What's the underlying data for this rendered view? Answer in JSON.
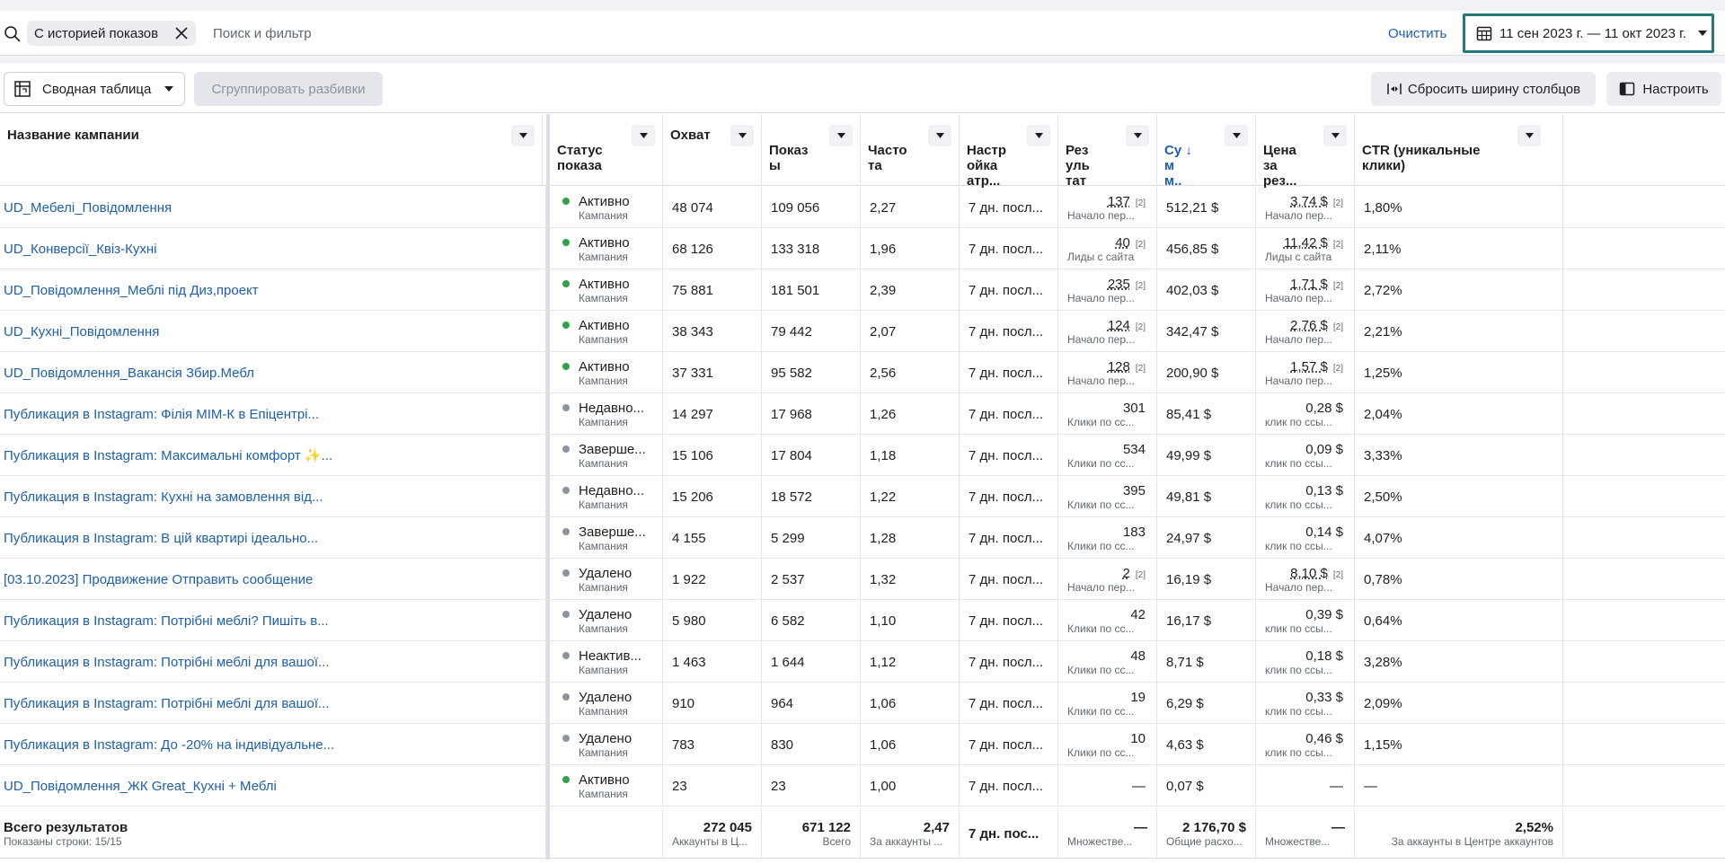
{
  "filter": {
    "chip_label": "С историей показов",
    "placeholder": "Поиск и фильтр",
    "clear_label": "Очистить",
    "date_range": "11 сен 2023 г. — 11 окт 2023 г."
  },
  "toolbar": {
    "pivot_label": "Сводная таблица",
    "group_label": "Сгруппировать разбивки",
    "reset_label": "Сбросить ширину столбцов",
    "settings_label": "Настроить"
  },
  "columns": {
    "name": "Название кампании",
    "status": "Статус\nпоказа",
    "reach": "Охват",
    "impressions": "Показ\nы",
    "frequency": "Часто\nта",
    "attribution": "Настр\nойка\nатр...",
    "results": "Рез\nуль\nтат",
    "spend": "Су ↓\nм\nм..",
    "cost": "Цена\nза\nрез...",
    "ctr": "CTR (уникальные\nклики)"
  },
  "rows": [
    {
      "name": "UD_Мебелі_Повідомлення",
      "status": "Активно",
      "status_sub": "Кампания",
      "active": true,
      "reach": "48 074",
      "impressions": "109 056",
      "frequency": "2,27",
      "attribution": "7 дн. посл...",
      "results": "137",
      "results_sup": "[2]",
      "results_label": "Начало пер...",
      "spend": "512,21 $",
      "cost": "3,74 $",
      "cost_sup": "[2]",
      "cost_label": "Начало пер...",
      "ctr": "1,80%"
    },
    {
      "name": "UD_Конверсії_Квіз-Кухні",
      "status": "Активно",
      "status_sub": "Кампания",
      "active": true,
      "reach": "68 126",
      "impressions": "133 318",
      "frequency": "1,96",
      "attribution": "7 дн. посл...",
      "results": "40",
      "results_sup": "[2]",
      "results_label": "Лиды с сайта",
      "spend": "456,85 $",
      "cost": "11,42 $",
      "cost_sup": "[2]",
      "cost_label": "Лиды с сайта",
      "ctr": "2,11%"
    },
    {
      "name": "UD_Повідомлення_Меблі під Диз,проект",
      "status": "Активно",
      "status_sub": "Кампания",
      "active": true,
      "reach": "75 881",
      "impressions": "181 501",
      "frequency": "2,39",
      "attribution": "7 дн. посл...",
      "results": "235",
      "results_sup": "[2]",
      "results_label": "Начало пер...",
      "spend": "402,03 $",
      "cost": "1,71 $",
      "cost_sup": "[2]",
      "cost_label": "Начало пер...",
      "ctr": "2,72%"
    },
    {
      "name": "UD_Кухні_Повідомлення",
      "status": "Активно",
      "status_sub": "Кампания",
      "active": true,
      "reach": "38 343",
      "impressions": "79 442",
      "frequency": "2,07",
      "attribution": "7 дн. посл...",
      "results": "124",
      "results_sup": "[2]",
      "results_label": "Начало пер...",
      "spend": "342,47 $",
      "cost": "2,76 $",
      "cost_sup": "[2]",
      "cost_label": "Начало пер...",
      "ctr": "2,21%"
    },
    {
      "name": "UD_Повідомлення_Вакансія Збир.Мебл",
      "status": "Активно",
      "status_sub": "Кампания",
      "active": true,
      "reach": "37 331",
      "impressions": "95 582",
      "frequency": "2,56",
      "attribution": "7 дн. посл...",
      "results": "128",
      "results_sup": "[2]",
      "results_label": "Начало пер...",
      "spend": "200,90 $",
      "cost": "1,57 $",
      "cost_sup": "[2]",
      "cost_label": "Начало пер...",
      "ctr": "1,25%"
    },
    {
      "name": "Публикация в Instagram: Філія МІМ-К в Епіцентрі...",
      "status": "Недавно...",
      "status_sub": "Кампания",
      "active": false,
      "reach": "14 297",
      "impressions": "17 968",
      "frequency": "1,26",
      "attribution": "7 дн. посл...",
      "results": "301",
      "results_sup": "",
      "results_label": "Клики по сс...",
      "spend": "85,41 $",
      "cost": "0,28 $",
      "cost_sup": "",
      "cost_label": "клик по ссы...",
      "ctr": "2,04%"
    },
    {
      "name": "Публикация в Instagram: Максимальні комфорт ✨...",
      "status": "Заверше...",
      "status_sub": "Кампания",
      "active": false,
      "reach": "15 106",
      "impressions": "17 804",
      "frequency": "1,18",
      "attribution": "7 дн. посл...",
      "results": "534",
      "results_sup": "",
      "results_label": "Клики по сс...",
      "spend": "49,99 $",
      "cost": "0,09 $",
      "cost_sup": "",
      "cost_label": "клик по ссы...",
      "ctr": "3,33%"
    },
    {
      "name": "Публикация в Instagram: Кухні на замовлення від...",
      "status": "Недавно...",
      "status_sub": "Кампания",
      "active": false,
      "reach": "15 206",
      "impressions": "18 572",
      "frequency": "1,22",
      "attribution": "7 дн. посл...",
      "results": "395",
      "results_sup": "",
      "results_label": "Клики по сс...",
      "spend": "49,81 $",
      "cost": "0,13 $",
      "cost_sup": "",
      "cost_label": "клик по ссы...",
      "ctr": "2,50%"
    },
    {
      "name": "Публикация в Instagram: В цій квартирі ідеально...",
      "status": "Заверше...",
      "status_sub": "Кампания",
      "active": false,
      "reach": "4 155",
      "impressions": "5 299",
      "frequency": "1,28",
      "attribution": "7 дн. посл...",
      "results": "183",
      "results_sup": "",
      "results_label": "Клики по сс...",
      "spend": "24,97 $",
      "cost": "0,14 $",
      "cost_sup": "",
      "cost_label": "клик по ссы...",
      "ctr": "4,07%"
    },
    {
      "name": "[03.10.2023] Продвижение Отправить сообщение",
      "status": "Удалено",
      "status_sub": "Кампания",
      "active": false,
      "reach": "1 922",
      "impressions": "2 537",
      "frequency": "1,32",
      "attribution": "7 дн. посл...",
      "results": "2",
      "results_sup": "[2]",
      "results_label": "Начало пер...",
      "spend": "16,19 $",
      "cost": "8,10 $",
      "cost_sup": "[2]",
      "cost_label": "Начало пер...",
      "ctr": "0,78%"
    },
    {
      "name": "Публикация в Instagram: Потрібні меблі? Пишіть в...",
      "status": "Удалено",
      "status_sub": "Кампания",
      "active": false,
      "reach": "5 980",
      "impressions": "6 582",
      "frequency": "1,10",
      "attribution": "7 дн. посл...",
      "results": "42",
      "results_sup": "",
      "results_label": "Клики по сс...",
      "spend": "16,17 $",
      "cost": "0,39 $",
      "cost_sup": "",
      "cost_label": "клик по ссы...",
      "ctr": "0,64%"
    },
    {
      "name": "Публикация в Instagram: Потрібні меблі для вашої...",
      "status": "Неактив...",
      "status_sub": "Кампания",
      "active": false,
      "reach": "1 463",
      "impressions": "1 644",
      "frequency": "1,12",
      "attribution": "7 дн. посл...",
      "results": "48",
      "results_sup": "",
      "results_label": "Клики по сс...",
      "spend": "8,71 $",
      "cost": "0,18 $",
      "cost_sup": "",
      "cost_label": "клик по ссы...",
      "ctr": "3,28%"
    },
    {
      "name": "Публикация в Instagram: Потрібні меблі для вашої...",
      "status": "Удалено",
      "status_sub": "Кампания",
      "active": false,
      "reach": "910",
      "impressions": "964",
      "frequency": "1,06",
      "attribution": "7 дн. посл...",
      "results": "19",
      "results_sup": "",
      "results_label": "Клики по сс...",
      "spend": "6,29 $",
      "cost": "0,33 $",
      "cost_sup": "",
      "cost_label": "клик по ссы...",
      "ctr": "2,09%"
    },
    {
      "name": "Публикация в Instagram: До -20% на індивідуальне...",
      "status": "Удалено",
      "status_sub": "Кампания",
      "active": false,
      "reach": "783",
      "impressions": "830",
      "frequency": "1,06",
      "attribution": "7 дн. посл...",
      "results": "10",
      "results_sup": "",
      "results_label": "Клики по сс...",
      "spend": "4,63 $",
      "cost": "0,46 $",
      "cost_sup": "",
      "cost_label": "клик по ссы...",
      "ctr": "1,15%"
    },
    {
      "name": "UD_Повідомлення_ЖК Great_Кухні + Меблі",
      "status": "Активно",
      "status_sub": "Кампания",
      "active": true,
      "reach": "23",
      "impressions": "23",
      "frequency": "1,00",
      "attribution": "7 дн. посл...",
      "results": "—",
      "results_sup": "",
      "results_label": "",
      "spend": "0,07 $",
      "cost": "—",
      "cost_sup": "",
      "cost_label": "",
      "ctr": "—"
    }
  ],
  "totals": {
    "title": "Всего результатов",
    "subtitle": "Показаны строки: 15/15",
    "reach": "272 045",
    "reach_label": "Аккаунты в Ц...",
    "impressions": "671 122",
    "impressions_label": "Всего",
    "frequency": "2,47",
    "frequency_label": "За аккаунты ...",
    "attribution": "7 дн. пос...",
    "results": "—",
    "results_label": "Множестве...",
    "spend": "2 176,70 $",
    "spend_label": "Общие расхо...",
    "cost": "—",
    "cost_label": "Множестве...",
    "ctr": "2,52%",
    "ctr_label": "За аккаунты в Центре аккаунтов"
  },
  "colors": {
    "active_dot": "#31a24c",
    "inactive_dot": "#8d949e",
    "link": "#1d5fb0",
    "date_border": "#25787a"
  }
}
